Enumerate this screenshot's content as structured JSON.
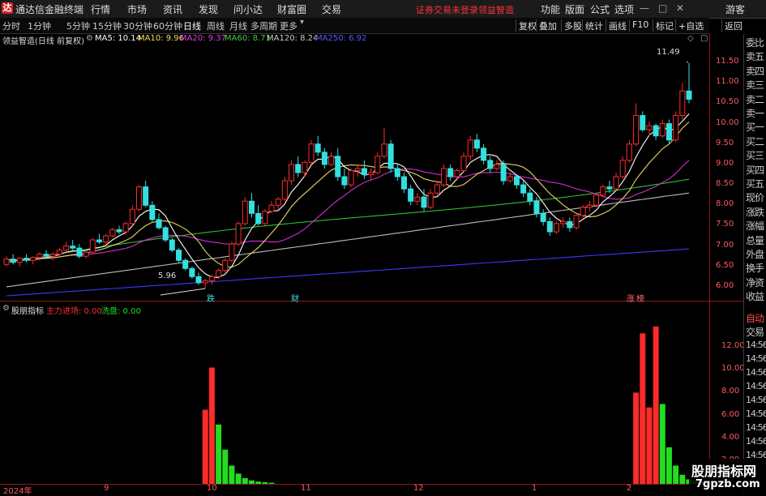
{
  "titlebar": {
    "app_name": "通达信金融终端",
    "menu": [
      "行情",
      "市场",
      "资讯",
      "发现",
      "问小达",
      "财富圈",
      "交易"
    ],
    "notice": "证券交易未登录",
    "stock": "领益智造",
    "right_menu": [
      "功能",
      "版面",
      "公式",
      "选项"
    ],
    "guest": "游客",
    "window_controls": [
      "minimize-icon",
      "restore-icon",
      "close-icon"
    ]
  },
  "periods": [
    "分时",
    "1分钟",
    "5分钟",
    "15分钟",
    "30分钟",
    "60分钟",
    "日线",
    "周线",
    "月线",
    "多周期",
    "更多"
  ],
  "active_period": "日线",
  "toolbar_right": [
    "复权",
    "叠加",
    "多股",
    "统计",
    "画线",
    "F10",
    "标记",
    "+自选",
    "返回"
  ],
  "chart_header": {
    "name": "领益智造(日线 前复权)",
    "ma": [
      {
        "label": "MA5: 10.14",
        "color": "#ffffff"
      },
      {
        "label": "MA10: 9.96",
        "color": "#f0e060"
      },
      {
        "label": "MA20: 9.37",
        "color": "#e040e0"
      },
      {
        "label": "MA60: 8.71",
        "color": "#40d040"
      },
      {
        "label": "MA120: 8.24",
        "color": "#cccccc"
      },
      {
        "label": "MA250: 6.92",
        "color": "#3a3aff"
      }
    ]
  },
  "price_axis": [
    "11.50",
    "11.00",
    "10.50",
    "10.00",
    "9.50",
    "9.00",
    "8.50",
    "8.00",
    "7.50",
    "7.00",
    "6.50",
    "6.00"
  ],
  "annotations": {
    "high": "11.49",
    "low": "5.96",
    "marks": [
      "跌",
      "财",
      "涨",
      "榜"
    ]
  },
  "indicator": {
    "name": "股朋指标",
    "main_label": "主力进场: 0.00",
    "wash_label": "洗盘: 0.00",
    "axis": [
      "12.00",
      "10.00",
      "8.00",
      "6.00",
      "4.00",
      "2.00"
    ],
    "right_times": [
      "14:56",
      "14:56",
      "14:56",
      "14:56",
      "14:56",
      "14:56",
      "14:56",
      "14:56",
      "14:56"
    ]
  },
  "right_panel": [
    "委比",
    "卖五",
    "卖四",
    "卖三",
    "卖二",
    "卖一",
    "买一",
    "买二",
    "买三",
    "买四",
    "买五",
    "现价",
    "涨跌",
    "涨幅",
    "总量",
    "外盘",
    "换手",
    "净资",
    "收益"
  ],
  "right_panel2": [
    "自动",
    "交易"
  ],
  "dates": [
    "2024年",
    "9",
    "10",
    "11",
    "12",
    "1",
    "2"
  ],
  "watermark": {
    "line1": "股朋指标网",
    "line2": "7gpzb.com"
  },
  "colors": {
    "up": "#ff2a2a",
    "down": "#33e0e0",
    "wash": "#22dd22",
    "axis": "#8b1a1a"
  },
  "chart_data": {
    "type": "candlestick",
    "ylim": [
      5.8,
      11.7
    ],
    "ohlc": [
      [
        6.55,
        6.75,
        6.5,
        6.68
      ],
      [
        6.68,
        6.8,
        6.55,
        6.6
      ],
      [
        6.6,
        6.72,
        6.5,
        6.7
      ],
      [
        6.7,
        6.8,
        6.6,
        6.65
      ],
      [
        6.65,
        6.75,
        6.55,
        6.72
      ],
      [
        6.72,
        6.85,
        6.65,
        6.8
      ],
      [
        6.8,
        6.9,
        6.7,
        6.75
      ],
      [
        6.75,
        6.85,
        6.65,
        6.8
      ],
      [
        6.8,
        6.95,
        6.75,
        6.9
      ],
      [
        6.9,
        7.1,
        6.85,
        7.0
      ],
      [
        7.0,
        7.15,
        6.9,
        6.95
      ],
      [
        6.95,
        7.05,
        6.7,
        6.75
      ],
      [
        6.75,
        6.9,
        6.7,
        6.85
      ],
      [
        6.85,
        7.2,
        6.8,
        7.15
      ],
      [
        7.15,
        7.3,
        7.05,
        7.1
      ],
      [
        7.1,
        7.3,
        7.0,
        7.25
      ],
      [
        7.25,
        7.45,
        7.2,
        7.4
      ],
      [
        7.4,
        7.5,
        7.3,
        7.35
      ],
      [
        7.35,
        7.6,
        7.3,
        7.55
      ],
      [
        7.55,
        8.0,
        7.5,
        7.9
      ],
      [
        7.9,
        8.5,
        7.85,
        8.45
      ],
      [
        8.45,
        8.6,
        7.95,
        8.0
      ],
      [
        8.0,
        8.1,
        7.6,
        7.65
      ],
      [
        7.65,
        7.8,
        7.4,
        7.45
      ],
      [
        7.45,
        7.5,
        7.1,
        7.15
      ],
      [
        7.15,
        7.2,
        6.85,
        6.9
      ],
      [
        6.9,
        6.95,
        6.6,
        6.65
      ],
      [
        6.65,
        6.7,
        6.4,
        6.45
      ],
      [
        6.45,
        6.5,
        6.2,
        6.25
      ],
      [
        6.25,
        6.35,
        6.05,
        6.1
      ],
      [
        6.1,
        6.2,
        5.96,
        6.15
      ],
      [
        6.15,
        6.3,
        6.05,
        6.25
      ],
      [
        6.25,
        6.45,
        6.2,
        6.4
      ],
      [
        6.4,
        6.7,
        6.35,
        6.65
      ],
      [
        6.65,
        7.1,
        6.6,
        7.05
      ],
      [
        7.05,
        7.6,
        7.0,
        7.55
      ],
      [
        7.55,
        8.2,
        7.5,
        8.1
      ],
      [
        8.1,
        8.3,
        7.7,
        7.8
      ],
      [
        7.8,
        8.0,
        7.5,
        7.55
      ],
      [
        7.55,
        7.9,
        7.5,
        7.85
      ],
      [
        7.85,
        8.1,
        7.8,
        8.0
      ],
      [
        8.0,
        8.2,
        7.9,
        8.15
      ],
      [
        8.15,
        8.7,
        8.1,
        8.6
      ],
      [
        8.6,
        9.1,
        8.5,
        9.0
      ],
      [
        9.0,
        9.2,
        8.7,
        8.8
      ],
      [
        8.8,
        9.1,
        8.7,
        9.05
      ],
      [
        9.05,
        9.6,
        9.0,
        9.5
      ],
      [
        9.5,
        9.7,
        9.2,
        9.3
      ],
      [
        9.3,
        9.4,
        8.9,
        9.0
      ],
      [
        9.0,
        9.3,
        8.95,
        9.2
      ],
      [
        9.2,
        9.4,
        8.6,
        8.7
      ],
      [
        8.7,
        8.9,
        8.4,
        8.5
      ],
      [
        8.5,
        8.9,
        8.45,
        8.85
      ],
      [
        8.85,
        9.0,
        8.7,
        8.9
      ],
      [
        8.9,
        9.1,
        8.65,
        8.75
      ],
      [
        8.75,
        8.9,
        8.6,
        8.8
      ],
      [
        8.8,
        9.3,
        8.75,
        9.2
      ],
      [
        9.2,
        9.9,
        9.15,
        9.5
      ],
      [
        9.5,
        9.6,
        8.8,
        8.9
      ],
      [
        8.9,
        9.0,
        8.6,
        8.7
      ],
      [
        8.7,
        8.8,
        8.3,
        8.4
      ],
      [
        8.4,
        8.5,
        8.0,
        8.1
      ],
      [
        8.1,
        8.3,
        8.0,
        8.2
      ],
      [
        8.2,
        8.4,
        7.85,
        7.95
      ],
      [
        7.95,
        8.4,
        7.9,
        8.3
      ],
      [
        8.3,
        8.6,
        8.25,
        8.5
      ],
      [
        8.5,
        9.0,
        8.45,
        8.9
      ],
      [
        8.9,
        9.0,
        8.6,
        8.7
      ],
      [
        8.7,
        8.9,
        8.6,
        8.85
      ],
      [
        8.85,
        9.3,
        8.8,
        9.2
      ],
      [
        9.2,
        9.7,
        9.1,
        9.6
      ],
      [
        9.6,
        9.75,
        9.3,
        9.4
      ],
      [
        9.4,
        9.5,
        9.0,
        9.1
      ],
      [
        9.1,
        9.2,
        8.8,
        8.9
      ],
      [
        8.9,
        9.1,
        8.85,
        9.0
      ],
      [
        9.0,
        9.1,
        8.5,
        8.6
      ],
      [
        8.6,
        8.8,
        8.55,
        8.7
      ],
      [
        8.7,
        8.75,
        8.4,
        8.5
      ],
      [
        8.5,
        8.6,
        8.2,
        8.3
      ],
      [
        8.3,
        8.4,
        8.0,
        8.1
      ],
      [
        8.1,
        8.2,
        7.7,
        7.8
      ],
      [
        7.8,
        7.9,
        7.5,
        7.6
      ],
      [
        7.6,
        7.7,
        7.25,
        7.35
      ],
      [
        7.35,
        7.6,
        7.3,
        7.55
      ],
      [
        7.55,
        7.7,
        7.45,
        7.6
      ],
      [
        7.6,
        7.7,
        7.35,
        7.45
      ],
      [
        7.45,
        7.8,
        7.4,
        7.75
      ],
      [
        7.75,
        8.0,
        7.7,
        7.95
      ],
      [
        7.95,
        8.1,
        7.85,
        8.0
      ],
      [
        8.0,
        8.3,
        7.95,
        8.25
      ],
      [
        8.25,
        8.5,
        8.2,
        8.45
      ],
      [
        8.45,
        8.6,
        8.3,
        8.4
      ],
      [
        8.4,
        8.8,
        8.35,
        8.7
      ],
      [
        8.7,
        9.2,
        8.65,
        9.1
      ],
      [
        9.1,
        9.6,
        9.05,
        9.5
      ],
      [
        9.5,
        10.5,
        9.45,
        10.2
      ],
      [
        10.2,
        10.3,
        9.8,
        9.85
      ],
      [
        9.85,
        10.05,
        9.7,
        9.95
      ],
      [
        9.95,
        10.0,
        9.6,
        9.7
      ],
      [
        9.7,
        10.1,
        9.65,
        10.0
      ],
      [
        10.0,
        10.1,
        9.5,
        9.6
      ],
      [
        9.6,
        10.3,
        9.55,
        10.2
      ],
      [
        10.2,
        11.0,
        10.1,
        10.8
      ],
      [
        10.8,
        11.49,
        10.5,
        10.6
      ]
    ],
    "indicator_red": [
      {
        "i": 30,
        "v": 6.5
      },
      {
        "i": 31,
        "v": 10.2
      },
      {
        "i": 95,
        "v": 8.0
      },
      {
        "i": 96,
        "v": 13.2
      },
      {
        "i": 97,
        "v": 6.7
      },
      {
        "i": 98,
        "v": 13.8
      }
    ],
    "indicator_green": [
      {
        "i": 32,
        "v": 5.2
      },
      {
        "i": 33,
        "v": 3.0
      },
      {
        "i": 34,
        "v": 1.6
      },
      {
        "i": 35,
        "v": 0.9
      },
      {
        "i": 36,
        "v": 0.5
      },
      {
        "i": 37,
        "v": 0.3
      },
      {
        "i": 38,
        "v": 0.2
      },
      {
        "i": 39,
        "v": 0.15
      },
      {
        "i": 40,
        "v": 0.1
      },
      {
        "i": 96,
        "v": 6.5
      },
      {
        "i": 99,
        "v": 7.0
      },
      {
        "i": 100,
        "v": 3.2
      },
      {
        "i": 101,
        "v": 1.6
      },
      {
        "i": 102,
        "v": 0.8
      },
      {
        "i": 103,
        "v": 0.4
      },
      {
        "i": 104,
        "v": 0.25
      },
      {
        "i": 105,
        "v": 0.15
      }
    ],
    "indicator_ylim": [
      0,
      14.5
    ]
  }
}
